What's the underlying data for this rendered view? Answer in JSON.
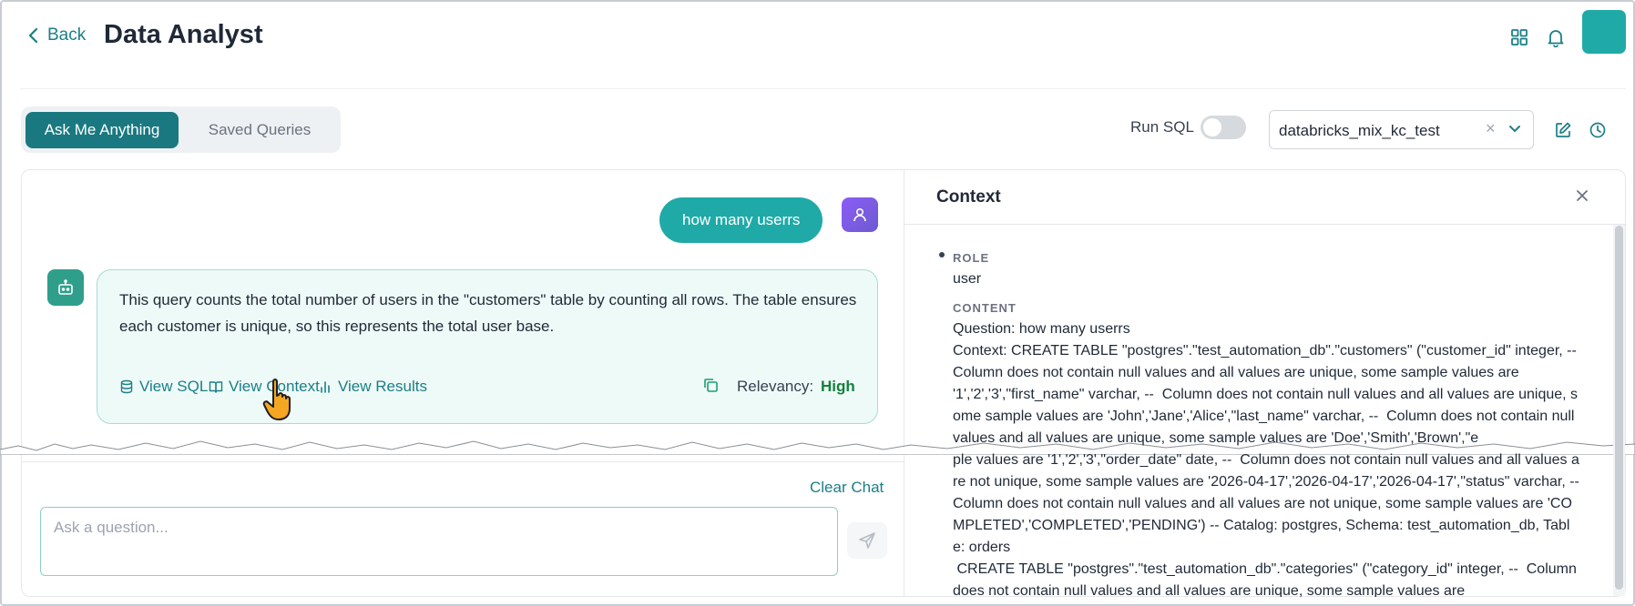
{
  "header": {
    "back_label": "Back",
    "title": "Data Analyst",
    "icons": [
      "grid-icon",
      "bell-icon"
    ]
  },
  "tabs": [
    {
      "label": "Ask Me Anything",
      "active": true
    },
    {
      "label": "Saved Queries",
      "active": false
    }
  ],
  "toolbar": {
    "run_sql_label": "Run SQL",
    "run_sql_enabled": false,
    "database_select_value": "databricks_mix_kc_test",
    "clear_symbol": "×"
  },
  "chat": {
    "user_message": "how many userrs",
    "bot_message": "This query counts the total number of users in the \"customers\" table by counting all rows. The table ensures each customer is unique, so this represents the total user base.",
    "actions": {
      "view_sql": "View SQL",
      "view_context": "View Context",
      "view_results": "View Results"
    },
    "relevancy_label": "Relevancy:",
    "relevancy_value": "High",
    "clear_chat": "Clear Chat",
    "input_placeholder": "Ask a question..."
  },
  "context_panel": {
    "title": "Context",
    "role_label": "ROLE",
    "role_value": "user",
    "content_label": "CONTENT",
    "content_text": "Question: how many userrs\nContext: CREATE TABLE \"postgres\".\"test_automation_db\".\"customers\" (\"customer_id\" integer, --  Column does not contain null values and all values are unique, some sample values are '1','2','3',\"first_name\" varchar, --  Column does not contain null values and all values are unique, some sample values are 'John','Jane','Alice',\"last_name\" varchar, --  Column does not contain null values and all values are unique, some sample values are 'Doe','Smith','Brown',\"e\nple values are '1','2','3',\"order_date\" date, --  Column does not contain null values and all values are not unique, some sample values are '2026-04-17','2026-04-17','2026-04-17',\"status\" varchar, --  Column does not contain null values and all values are not unique, some sample values are 'COMPLETED','COMPLETED','PENDING') -- Catalog: postgres, Schema: test_automation_db, Table: orders\n CREATE TABLE \"postgres\".\"test_automation_db\".\"categories\" (\"category_id\" integer, --  Column does not contain null values and all values are unique, some sample values are"
  },
  "colors": {
    "accent": "#1a7f86",
    "primary_fill": "#1faaa7",
    "bubble_bg": "#eefaf8",
    "relevancy_high": "#15803d"
  }
}
